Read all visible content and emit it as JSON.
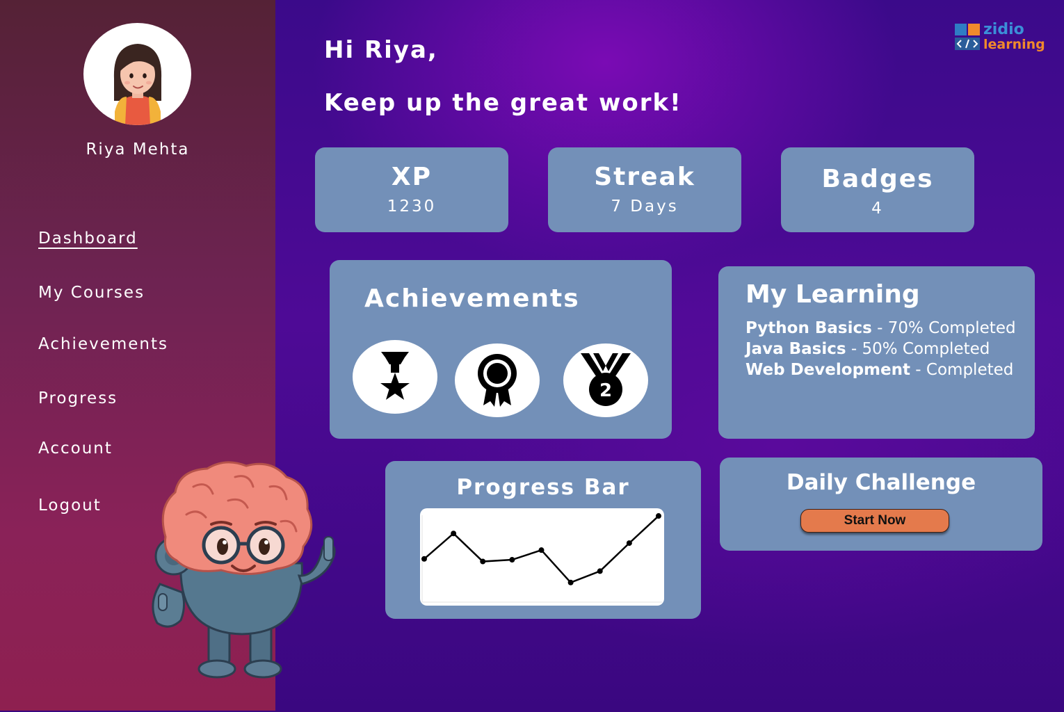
{
  "user": {
    "name": "Riya Mehta"
  },
  "sidebar": {
    "items": [
      {
        "label": "Dashboard",
        "active": true
      },
      {
        "label": "My Courses"
      },
      {
        "label": "Achievements"
      },
      {
        "label": "Progress"
      },
      {
        "label": "Account"
      },
      {
        "label": "Logout"
      }
    ]
  },
  "logo": {
    "line1": "zidio",
    "line2": "learning"
  },
  "greeting": {
    "line1": "Hi Riya,",
    "line2": "Keep up the great work!"
  },
  "stats": [
    {
      "label": "XP",
      "value": "1230"
    },
    {
      "label": "Streak",
      "value": "7 Days"
    },
    {
      "label": "Badges",
      "value": "4"
    }
  ],
  "achievements": {
    "title": "Achievements",
    "badges": [
      "star-medal-icon",
      "rosette-award-icon",
      "second-place-medal-icon"
    ],
    "second_place_number": "2"
  },
  "learning": {
    "title": "My Learning",
    "courses": [
      {
        "name": "Python Basics",
        "status": " - 70% Completed"
      },
      {
        "name": "Java Basics",
        "status": " - 50% Completed"
      },
      {
        "name": "Web Development",
        "status": " - Completed"
      }
    ]
  },
  "progress": {
    "title": "Progress Bar"
  },
  "chart_data": {
    "type": "line",
    "title": "",
    "xlabel": "",
    "ylabel": "",
    "x": [
      1,
      2,
      3,
      4,
      5,
      6,
      7,
      8,
      9
    ],
    "series": [
      {
        "values": [
          4.7,
          7.6,
          4.4,
          4.6,
          5.7,
          2.0,
          3.3,
          6.5,
          9.6
        ]
      }
    ],
    "ylim": [
      0,
      10
    ],
    "grid": false
  },
  "challenge": {
    "title": "Daily Challenge",
    "button_label": "Start Now"
  },
  "colors": {
    "card": "#7390b8",
    "button": "#e47a4c",
    "sidebar": "#7a2350",
    "background": "#4e0a96"
  }
}
